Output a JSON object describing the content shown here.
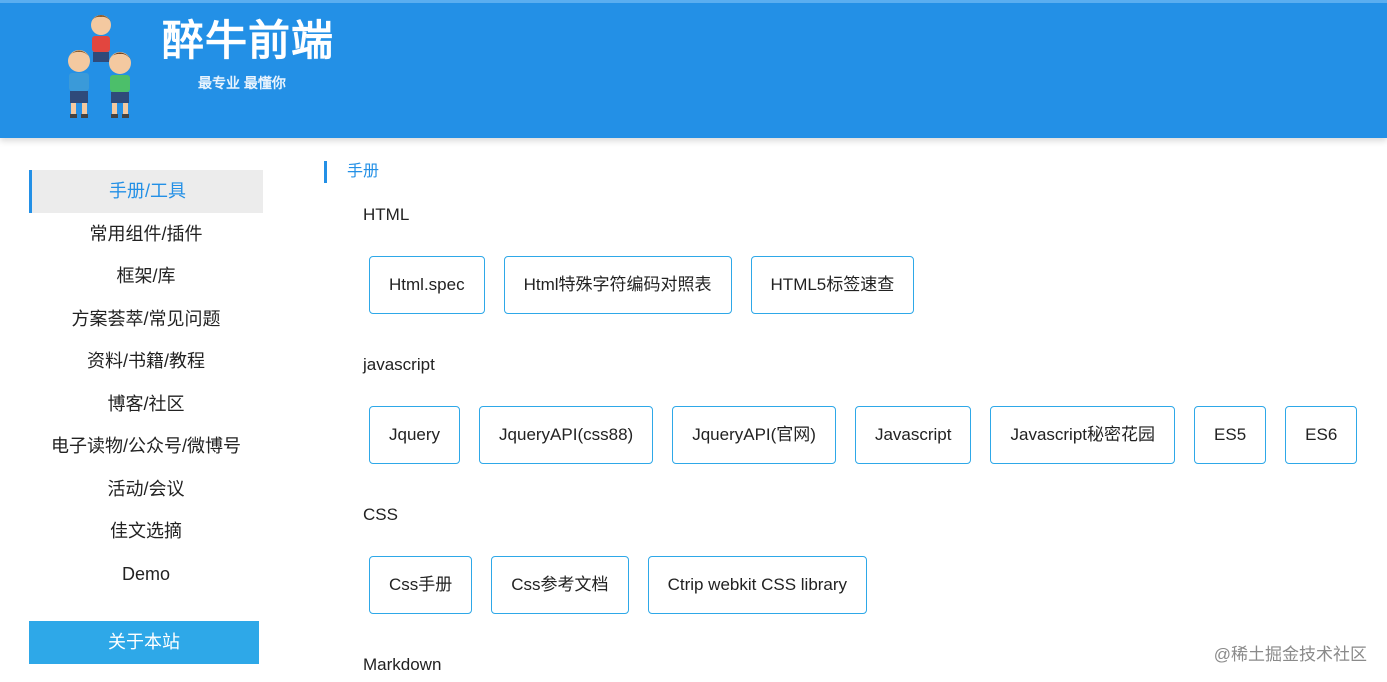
{
  "header": {
    "title": "醉牛前端",
    "subtitle": "最专业  最懂你"
  },
  "sidebar": {
    "items": [
      {
        "label": "手册/工具",
        "active": true
      },
      {
        "label": "常用组件/插件"
      },
      {
        "label": "框架/库"
      },
      {
        "label": "方案荟萃/常见问题"
      },
      {
        "label": "资料/书籍/教程"
      },
      {
        "label": "博客/社区"
      },
      {
        "label": "电子读物/公众号/微博号"
      },
      {
        "label": "活动/会议"
      },
      {
        "label": "佳文选摘"
      },
      {
        "label": "Demo"
      }
    ],
    "about_label": "关于本站"
  },
  "main": {
    "section_title": "手册",
    "categories": [
      {
        "heading": "HTML",
        "links": [
          "Html.spec",
          "Html特殊字符编码对照表",
          "HTML5标签速查"
        ]
      },
      {
        "heading": "javascript",
        "links": [
          "Jquery",
          "JqueryAPI(css88)",
          "JqueryAPI(官网)",
          "Javascript",
          "Javascript秘密花园",
          "ES5",
          "ES6"
        ]
      },
      {
        "heading": "CSS",
        "links": [
          "Css手册",
          "Css参考文档",
          "Ctrip webkit CSS library"
        ]
      },
      {
        "heading": "Markdown",
        "links": []
      }
    ]
  },
  "watermark": "@稀土掘金技术社区",
  "colors": {
    "header_bg": "#2390e6",
    "accent": "#2390e6",
    "button_border": "#2ea8e8",
    "about_bg": "#2ea8e8"
  }
}
